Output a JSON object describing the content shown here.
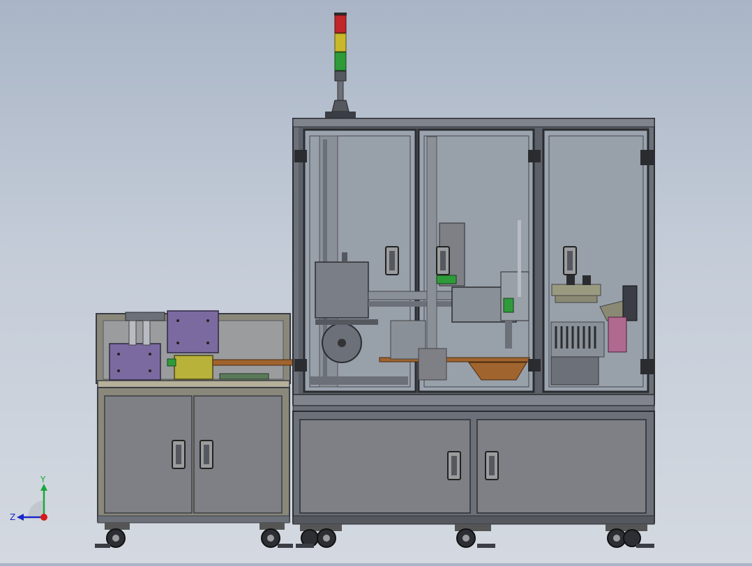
{
  "scene": {
    "kind": "cad-assembly-front-view",
    "background_top": "#a9b5c6",
    "background_bottom": "#d4d9e0"
  },
  "triad": {
    "y_label": "Y",
    "z_label": "Z",
    "y_color": "#1aa83a",
    "z_color": "#1a28c8",
    "origin_color": "#d41a1a"
  },
  "colors": {
    "frame": "#6c7078",
    "frame_dark": "#3a3d44",
    "panel": "#7e8086",
    "glass": "#9aa3ae",
    "left_frame": "#8c8a76",
    "purple": "#7b6aa0",
    "yellow": "#b8b23a",
    "copper": "#a0642e",
    "pink": "#b06a90",
    "beacon_red": "#c0262b",
    "beacon_yellow": "#c8b82a",
    "beacon_green": "#2f9a3a"
  },
  "icons": [
    "signal-tower-icon",
    "caster-wheel-icon",
    "door-handle-icon",
    "axis-triad-icon"
  ]
}
